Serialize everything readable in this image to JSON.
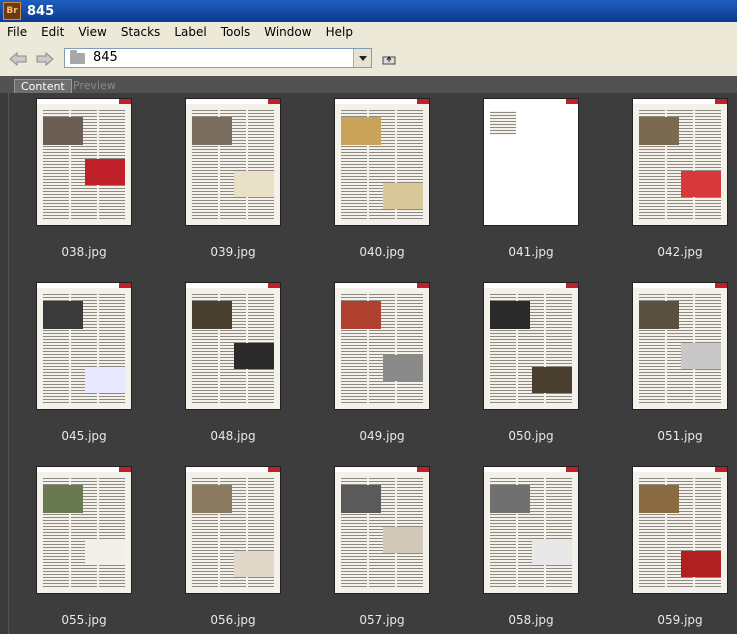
{
  "window": {
    "title": "845",
    "app_icon": "Br"
  },
  "menu": [
    "File",
    "Edit",
    "View",
    "Stacks",
    "Label",
    "Tools",
    "Window",
    "Help"
  ],
  "toolbar": {
    "path": "845",
    "back_icon": "back-arrow-icon",
    "forward_icon": "forward-arrow-icon"
  },
  "tabs": {
    "content": "Content",
    "preview": "Preview"
  },
  "files": [
    "038.jpg",
    "039.jpg",
    "040.jpg",
    "041.jpg",
    "042.jpg",
    "045.jpg",
    "048.jpg",
    "049.jpg",
    "050.jpg",
    "051.jpg",
    "055.jpg",
    "056.jpg",
    "057.jpg",
    "058.jpg",
    "059.jpg"
  ]
}
